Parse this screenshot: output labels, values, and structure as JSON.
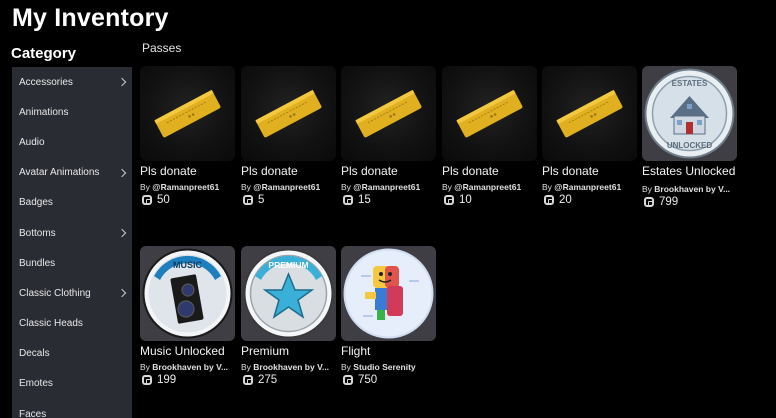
{
  "page": {
    "title": "My Inventory"
  },
  "sidebar": {
    "heading": "Category",
    "items": [
      {
        "label": "Accessories",
        "chevron": true
      },
      {
        "label": "Animations",
        "chevron": false
      },
      {
        "label": "Audio",
        "chevron": false
      },
      {
        "label": "Avatar Animations",
        "chevron": true
      },
      {
        "label": "Badges",
        "chevron": false
      },
      {
        "label": "Bottoms",
        "chevron": true
      },
      {
        "label": "Bundles",
        "chevron": false
      },
      {
        "label": "Classic Clothing",
        "chevron": true
      },
      {
        "label": "Classic Heads",
        "chevron": false
      },
      {
        "label": "Decals",
        "chevron": false
      },
      {
        "label": "Emotes",
        "chevron": false
      },
      {
        "label": "Faces",
        "chevron": false
      }
    ]
  },
  "section": {
    "label": "Passes"
  },
  "items": [
    {
      "name": "Pls donate",
      "by": "By",
      "creator": "@Ramanpreet61",
      "price": "50",
      "thumb": "ticket"
    },
    {
      "name": "Pls donate",
      "by": "By",
      "creator": "@Ramanpreet61",
      "price": "5",
      "thumb": "ticket"
    },
    {
      "name": "Pls donate",
      "by": "By",
      "creator": "@Ramanpreet61",
      "price": "15",
      "thumb": "ticket"
    },
    {
      "name": "Pls donate",
      "by": "By",
      "creator": "@Ramanpreet61",
      "price": "10",
      "thumb": "ticket"
    },
    {
      "name": "Pls donate",
      "by": "By",
      "creator": "@Ramanpreet61",
      "price": "20",
      "thumb": "ticket"
    },
    {
      "name": "Estates Unlocked",
      "by": "By",
      "creator": "Brookhaven by V...",
      "price": "799",
      "thumb": "estates",
      "badge_top": "ESTATES",
      "badge_bottom": "UNLOCKED"
    },
    {
      "name": "Music Unlocked",
      "by": "By",
      "creator": "Brookhaven by V...",
      "price": "199",
      "thumb": "music",
      "badge_top": "MUSIC"
    },
    {
      "name": "Premium",
      "by": "By",
      "creator": "Brookhaven by V...",
      "price": "275",
      "thumb": "premium",
      "badge_top": "PREMIUM"
    },
    {
      "name": "Flight",
      "by": "By",
      "creator": "Studio Serenity",
      "price": "750",
      "thumb": "flight"
    }
  ],
  "icons": {
    "chevron": "chevron-right-icon",
    "currency": "robux-icon"
  },
  "colors": {
    "background": "#000000",
    "sidebar": "#2a2c33",
    "ticket": "#e0b020",
    "badge_blue": "#1e7fbf",
    "star": "#3ab0d8"
  }
}
